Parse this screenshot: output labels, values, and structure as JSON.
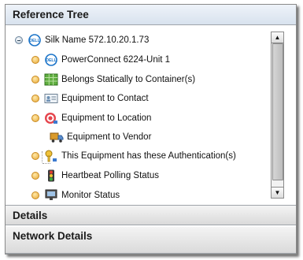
{
  "panels": {
    "reference_tree": "Reference Tree",
    "details": "Details",
    "network_details": "Network Details"
  },
  "tree": {
    "root": {
      "label": "Silk Name 572.10.20.1.73",
      "icon": "dell-logo-icon"
    },
    "children": [
      {
        "label": "PowerConnect 6224-Unit 1",
        "icon": "dell-logo-icon"
      },
      {
        "label": "Belongs Statically to Container(s)",
        "icon": "container-grid-icon"
      },
      {
        "label": "Equipment to Contact",
        "icon": "contact-card-icon"
      },
      {
        "label": "Equipment to Location",
        "icon": "location-target-icon"
      },
      {
        "label": "Equipment to Vendor",
        "icon": "vendor-truck-icon"
      },
      {
        "label": "This Equipment has these Authentication(s)",
        "icon": "key-icon"
      },
      {
        "label": "Heartbeat Polling Status",
        "icon": "traffic-light-icon"
      },
      {
        "label": "Monitor Status",
        "icon": "monitor-status-icon"
      }
    ]
  },
  "scrollbar": {
    "up_glyph": "▲",
    "down_glyph": "▼"
  },
  "colors": {
    "header_bg": "#dde6f0",
    "expander_orange": "#e8a93a",
    "dell_blue": "#1a73c8"
  }
}
